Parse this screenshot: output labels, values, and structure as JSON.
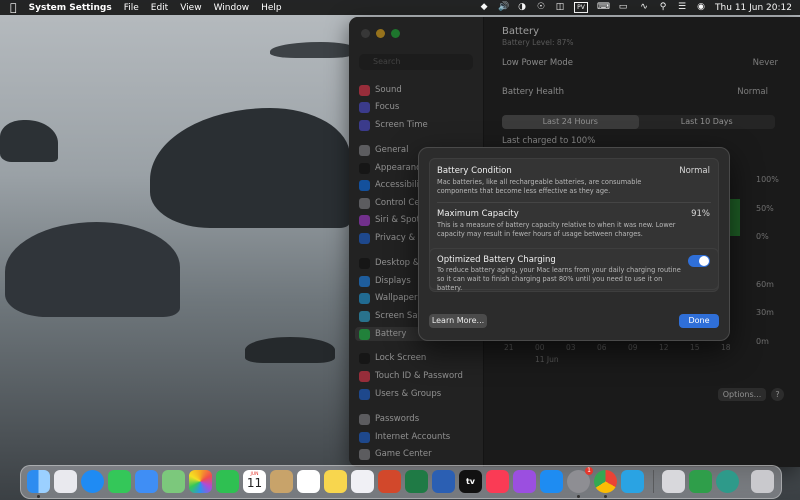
{
  "menubar": {
    "app_name": "System Settings",
    "menus": [
      "File",
      "Edit",
      "View",
      "Window",
      "Help"
    ],
    "clock": "Thu 11 Jun  20:12"
  },
  "sidebar": {
    "search_placeholder": "Search",
    "items": [
      {
        "label": "Sound",
        "color": "#e8465a"
      },
      {
        "label": "Focus",
        "color": "#5b5bd6"
      },
      {
        "label": "Screen Time",
        "color": "#5b5bd6"
      },
      {
        "label": "General",
        "color": "#8e8e93"
      },
      {
        "label": "Appearance",
        "color": "#222222"
      },
      {
        "label": "Accessibility",
        "color": "#1e7bf0"
      },
      {
        "label": "Control Centre",
        "color": "#8e8e93"
      },
      {
        "label": "Siri & Spotlight",
        "color": "#b04ad8"
      },
      {
        "label": "Privacy & Security",
        "color": "#2f6fd8"
      },
      {
        "label": "Desktop & Dock",
        "color": "#222222"
      },
      {
        "label": "Displays",
        "color": "#2f8ff0"
      },
      {
        "label": "Wallpaper",
        "color": "#33a5e0"
      },
      {
        "label": "Screen Saver",
        "color": "#40b0d8"
      },
      {
        "label": "Battery",
        "color": "#34c759"
      },
      {
        "label": "Lock Screen",
        "color": "#222222"
      },
      {
        "label": "Touch ID & Password",
        "color": "#e8465a"
      },
      {
        "label": "Users & Groups",
        "color": "#2f6fd8"
      },
      {
        "label": "Passwords",
        "color": "#8e8e93"
      },
      {
        "label": "Internet Accounts",
        "color": "#2f6fd8"
      },
      {
        "label": "Game Center",
        "color": "#8e8e93"
      }
    ]
  },
  "main": {
    "title": "Battery",
    "subtitle": "Battery Level: 87%",
    "low_power_label": "Low Power Mode",
    "low_power_value": "Never",
    "health_label": "Battery Health",
    "health_value": "Normal",
    "tabs": [
      "Last 24 Hours",
      "Last 10 Days"
    ],
    "last_charged": "Last charged to 100%",
    "pct_labels": [
      "100%",
      "50%",
      "0%"
    ],
    "time_labels": [
      "60m",
      "30m",
      "0m"
    ],
    "x_labels": [
      "21",
      "00",
      "03",
      "06",
      "09",
      "12",
      "15",
      "18"
    ],
    "x_date": "11 Jun",
    "options_label": "Options...",
    "help_label": "?"
  },
  "sheet": {
    "condition_title": "Battery Condition",
    "condition_desc": "Mac batteries, like all rechargeable batteries, are consumable components that become less effective as they age.",
    "condition_value": "Normal",
    "capacity_title": "Maximum Capacity",
    "capacity_desc": "This is a measure of battery capacity relative to when it was new. Lower capacity may result in fewer hours of usage between charges.",
    "capacity_value": "91%",
    "optimized_title": "Optimized Battery Charging",
    "optimized_desc": "To reduce battery aging, your Mac learns from your daily charging routine so it can wait to finish charging past 80% until you need to use it on battery.",
    "optimized_on": true,
    "learn_more": "Learn More...",
    "done": "Done"
  },
  "dock": {
    "calendar_month": "JUN",
    "calendar_day": "11",
    "appstore_badge": "1",
    "tv_label": "tv"
  }
}
